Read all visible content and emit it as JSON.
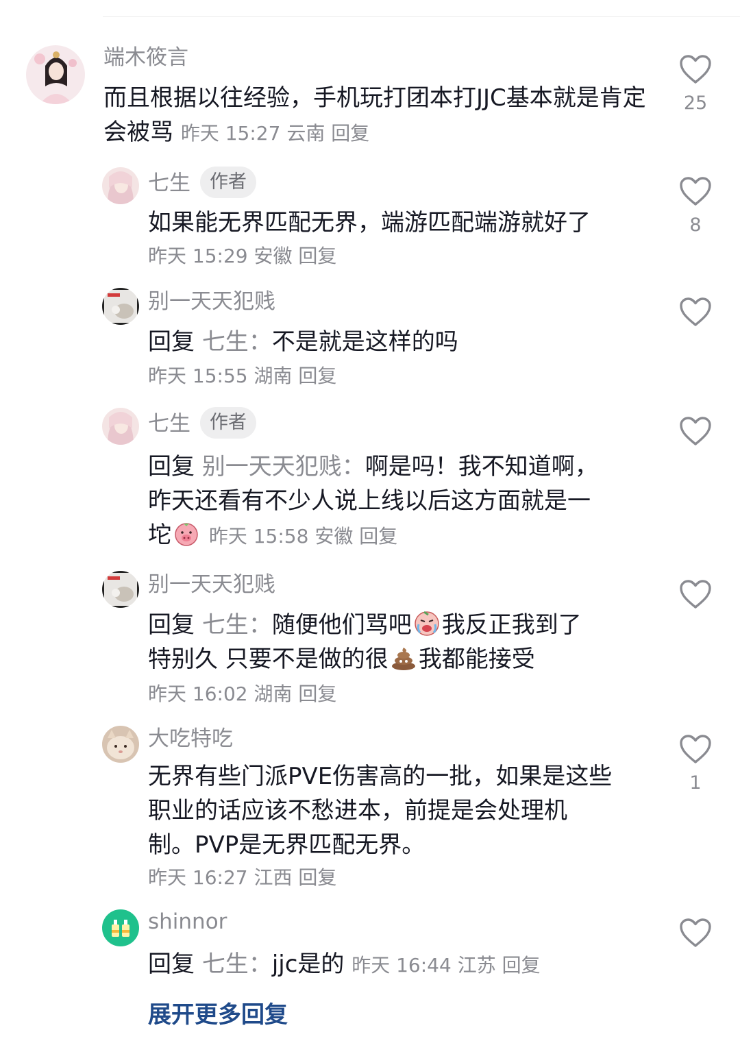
{
  "comments": [
    {
      "user": "端木筱言",
      "text": "而且根据以往经验，手机玩打团本打JJC基本就是肯定会被骂",
      "time": "昨天 15:27",
      "location": "云南",
      "reply_label": "回复",
      "likes": "25",
      "avatar": "avatar-ancient-lady"
    },
    {
      "user": "七生",
      "badge": "作者",
      "text": "如果能无界匹配无界，端游匹配端游就好了",
      "time": "昨天 15:29",
      "location": "安徽",
      "reply_label": "回复",
      "likes": "8",
      "avatar": "avatar-pink-hair"
    },
    {
      "user": "别一天天犯贱",
      "reply_prefix": "回复",
      "reply_to": "七生：",
      "text": "不是就是这样的吗",
      "time": "昨天 15:55",
      "location": "湖南",
      "reply_label": "回复",
      "avatar": "avatar-cat-meme"
    },
    {
      "user": "七生",
      "badge": "作者",
      "reply_prefix": "回复",
      "reply_to": "别一天天犯贱：",
      "text_line1": "啊是吗！我不知道啊，",
      "text_line2": "昨天还看有不少人说上线以后这方面就是一",
      "text_line3": "坨",
      "emoji": "pig-emoji",
      "time": "昨天 15:58",
      "location": "安徽",
      "reply_label": "回复",
      "avatar": "avatar-pink-hair"
    },
    {
      "user": "别一天天犯贱",
      "reply_prefix": "回复",
      "reply_to": "七生：",
      "text_part1": "随便他们骂吧",
      "emoji1": "crying-face-emoji",
      "text_part2": "我反正我到了",
      "text_part3": "特别久 只要不是做的很",
      "emoji2": "poop-emoji",
      "text_part4": "我都能接受",
      "time": "昨天 16:02",
      "location": "湖南",
      "reply_label": "回复",
      "avatar": "avatar-cat-meme"
    },
    {
      "user": "大吃特吃",
      "text_line1": "无界有些门派PVE伤害高的一批，如果是这些",
      "text_line2": "职业的话应该不愁进本，前提是会处理机",
      "text_line3": "制。PVP是无界匹配无界。",
      "time": "昨天 16:27",
      "location": "江西",
      "reply_label": "回复",
      "likes": "1",
      "avatar": "avatar-cat-photo"
    },
    {
      "user": "shinnor",
      "reply_prefix": "回复",
      "reply_to": "七生：",
      "text": "jjc是的",
      "time": "昨天 16:44",
      "location": "江苏",
      "reply_label": "回复",
      "avatar": "avatar-green-bottles"
    }
  ],
  "expand_label": "展开更多回复",
  "colors": {
    "text": "#161823",
    "meta": "#8a8b91",
    "link": "#1f4a8a",
    "badge_bg": "#eeeeef"
  },
  "icons": {
    "like": "heart-outline-icon"
  }
}
